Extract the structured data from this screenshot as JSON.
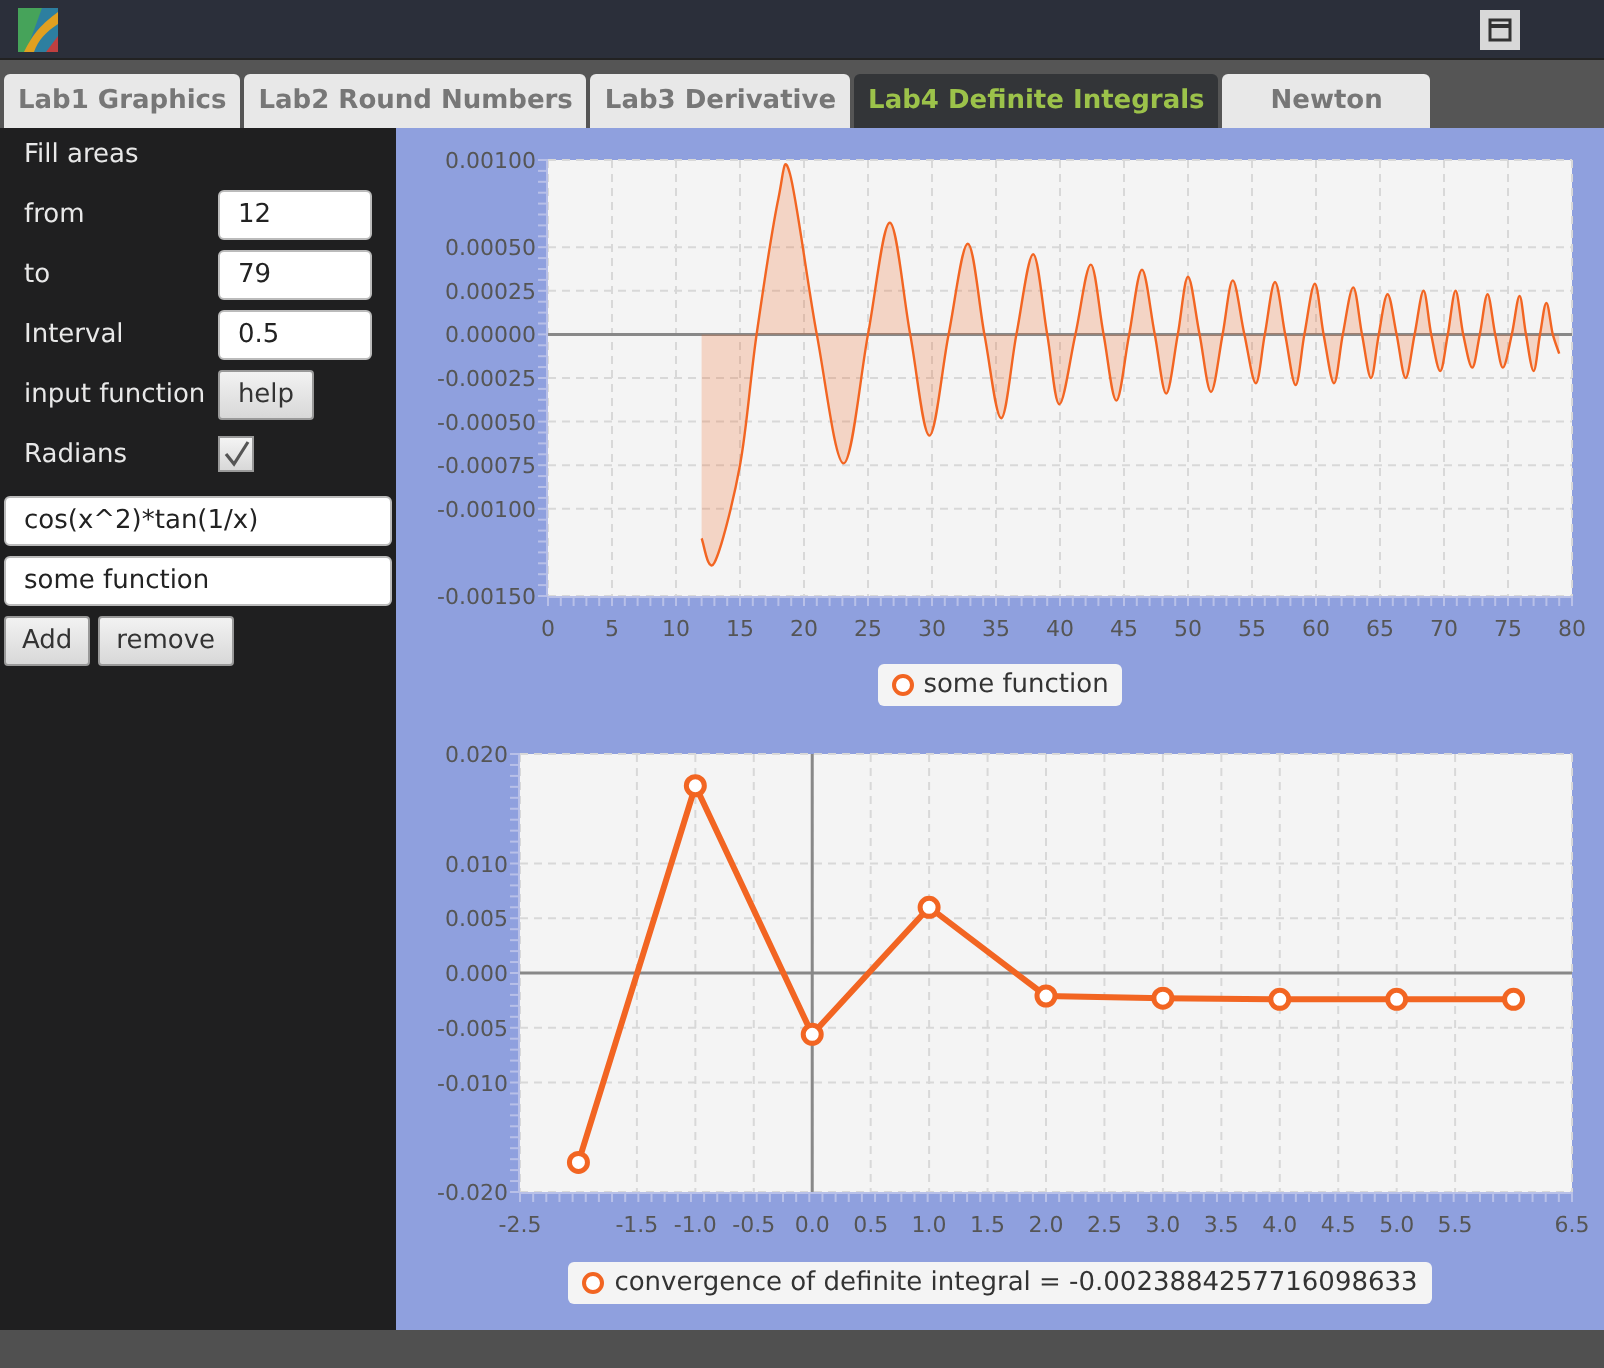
{
  "tabs": [
    {
      "label": "Lab1 Graphics",
      "selected": false
    },
    {
      "label": "Lab2 Round Numbers",
      "selected": false
    },
    {
      "label": "Lab3 Derivative",
      "selected": false
    },
    {
      "label": "Lab4 Definite Integrals",
      "selected": true
    },
    {
      "label": "Newton",
      "selected": false
    }
  ],
  "panel": {
    "heading": "Fill areas",
    "fields": [
      {
        "label": "from",
        "value": "12"
      },
      {
        "label": "to",
        "value": "79"
      },
      {
        "label": "Interval",
        "value": "0.5"
      }
    ],
    "help": {
      "label": "input function",
      "button": "help"
    },
    "radians": {
      "label": "Radians",
      "checked": true
    },
    "function_field": {
      "value": "cos(x^2)*tan(1/x)"
    },
    "name_field": {
      "value": "some function"
    },
    "buttons": [
      "Add",
      "remove"
    ]
  },
  "charts": [
    {
      "chart_data": {
        "type": "area",
        "x": [
          12,
          13,
          15,
          16.3,
          18,
          18.9,
          21,
          23.1,
          25,
          26.7,
          28.3,
          29.8,
          31.3,
          32.8,
          34.1,
          35.4,
          36.6,
          37.9,
          39,
          39.95,
          41.2,
          42.4,
          43.4,
          44.4,
          45.4,
          46.4,
          47.4,
          48.3,
          49.2,
          50,
          50.9,
          51.8,
          52.7,
          53.5,
          54.4,
          55.3,
          56,
          56.8,
          57.6,
          58.4,
          59.1,
          59.9,
          60.6,
          61.4,
          62.1,
          62.9,
          63.6,
          64.3,
          64.9,
          65.6,
          66.3,
          67,
          67.7,
          68.4,
          69,
          69.7,
          70.3,
          70.9,
          71.5,
          72.2,
          72.8,
          73.4,
          74,
          74.6,
          75.3,
          75.9,
          76.4,
          77,
          77.5,
          78,
          78.5,
          79
        ],
        "series": [
          {
            "name": "some function",
            "color": "#f26522",
            "values": [
              -0.00117,
              -0.00131,
              -0.00075,
              0,
              0.00078,
              0.00092,
              0,
              -0.00074,
              0,
              0.00064,
              0,
              -0.00058,
              0,
              0.00052,
              0,
              -0.00048,
              0,
              0.00046,
              0,
              -0.0004,
              0,
              0.0004,
              0,
              -0.00038,
              0,
              0.00037,
              0,
              -0.00034,
              0,
              0.00033,
              0,
              -0.00033,
              0,
              0.00031,
              0,
              -0.00028,
              0,
              0.0003,
              0,
              -0.00029,
              0,
              0.00029,
              0,
              -0.00028,
              0,
              0.00027,
              0,
              -0.00025,
              0,
              0.00023,
              0,
              -0.00025,
              0,
              0.00025,
              0,
              -0.00021,
              0,
              0.00025,
              0,
              -0.00019,
              0,
              0.00023,
              0,
              -0.00019,
              0,
              0.00022,
              0,
              -0.00021,
              0,
              0.00018,
              0,
              -0.00011
            ]
          }
        ],
        "grid": true,
        "xlim": [
          0,
          80
        ],
        "ylim": [
          -0.0015,
          0.001
        ],
        "xticks": [
          0,
          5,
          10,
          15,
          20,
          25,
          30,
          35,
          40,
          45,
          50,
          55,
          60,
          65,
          70,
          75,
          80
        ],
        "yticks": [
          {
            "value": 0.001,
            "label": "0.00100"
          },
          {
            "value": 0.0005,
            "label": "0.00050"
          },
          {
            "value": 0.00025,
            "label": "0.00025"
          },
          {
            "value": 0,
            "label": "0.00000"
          },
          {
            "value": -0.00025,
            "label": "-0.00025"
          },
          {
            "value": -0.0005,
            "label": "-0.00050"
          },
          {
            "value": -0.00075,
            "label": "-0.00075"
          },
          {
            "value": -0.001,
            "label": "-0.00100"
          },
          {
            "value": -0.0015,
            "label": "-0.00150"
          }
        ]
      }
    },
    {
      "chart_data": {
        "type": "line",
        "x": [
          -2,
          -1,
          0,
          1,
          2,
          3,
          4,
          5,
          6
        ],
        "grid": true,
        "series": [
          {
            "name": "convergence of definite integral = -0.0023884257716098633",
            "color": "#f26522",
            "marker": "circle",
            "values": [
              -0.0173,
              0.0171,
              -0.0056,
              0.006,
              -0.0021,
              -0.0023,
              -0.0024,
              -0.0024,
              -0.0024
            ]
          }
        ],
        "xlim": [
          -2.5,
          6.5
        ],
        "ylim": [
          -0.02,
          0.02
        ],
        "xticks": [
          {
            "value": -2.5,
            "label": "-2.5"
          },
          {
            "value": -1.5,
            "label": "-1.5"
          },
          {
            "value": -1,
            "label": "-1.0"
          },
          {
            "value": -0.5,
            "label": "-0.5"
          },
          {
            "value": 0,
            "label": "0.0"
          },
          {
            "value": 0.5,
            "label": "0.5"
          },
          {
            "value": 1,
            "label": "1.0"
          },
          {
            "value": 1.5,
            "label": "1.5"
          },
          {
            "value": 2,
            "label": "2.0"
          },
          {
            "value": 2.5,
            "label": "2.5"
          },
          {
            "value": 3,
            "label": "3.0"
          },
          {
            "value": 3.5,
            "label": "3.5"
          },
          {
            "value": 4,
            "label": "4.0"
          },
          {
            "value": 4.5,
            "label": "4.5"
          },
          {
            "value": 5,
            "label": "5.0"
          },
          {
            "value": 5.5,
            "label": "5.5"
          },
          {
            "value": 6.5,
            "label": "6.5"
          }
        ],
        "yticks": [
          {
            "value": 0.02,
            "label": "0.020"
          },
          {
            "value": 0.01,
            "label": "0.010"
          },
          {
            "value": 0.005,
            "label": "0.005"
          },
          {
            "value": 0,
            "label": "0.000"
          },
          {
            "value": -0.005,
            "label": "-0.005"
          },
          {
            "value": -0.01,
            "label": "-0.010"
          },
          {
            "value": -0.02,
            "label": "-0.020"
          }
        ]
      }
    }
  ]
}
